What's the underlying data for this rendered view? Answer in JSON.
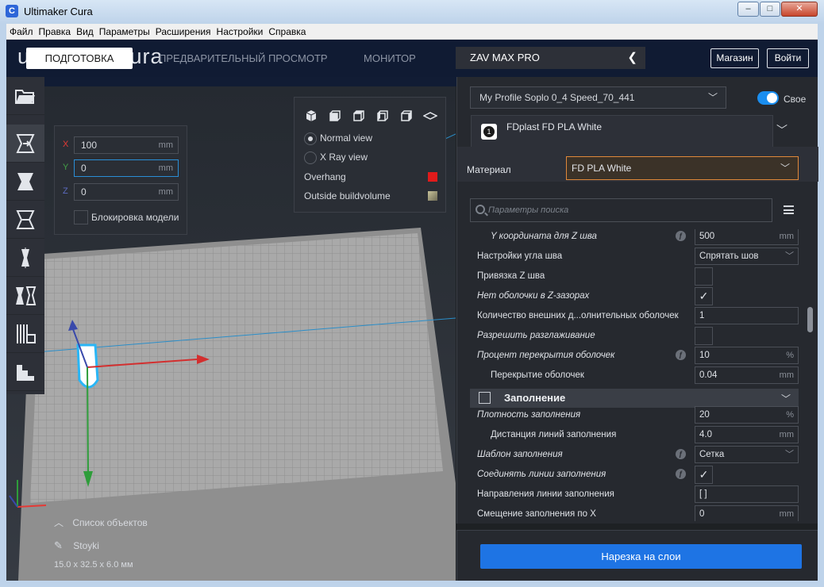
{
  "window": {
    "title": "Ultimaker Cura",
    "logo": "C",
    "buttons": [
      "–",
      "□",
      "✕"
    ]
  },
  "menubar": [
    "Файл",
    "Правка",
    "Вид",
    "Параметры",
    "Расширения",
    "Настройки",
    "Справка"
  ],
  "header": {
    "brand": "ultimaker cura",
    "stages": {
      "prepare": "ПОДГОТОВКА",
      "preview": "ПРЕДВАРИТЕЛЬНЫЙ ПРОСМОТР",
      "monitor": "МОНИТОР"
    },
    "printer": "ZAV MAX PRO",
    "shop": "Магазин",
    "login": "Войти"
  },
  "toolbar": {
    "icons": [
      "open-file-icon",
      "move-tool-icon",
      "scale-tool-icon",
      "rotate-tool-icon",
      "mirror-tool-icon",
      "per-model-settings-icon",
      "support-blocker-icon",
      "layflat-icon"
    ]
  },
  "move_panel": {
    "x": {
      "label": "X",
      "value": "100",
      "unit": "mm",
      "color": "#e53935"
    },
    "y": {
      "label": "Y",
      "value": "0",
      "unit": "mm",
      "color": "#43a047"
    },
    "z": {
      "label": "Z",
      "value": "0",
      "unit": "mm",
      "color": "#3f51b5"
    },
    "lock_label": "Блокировка модели"
  },
  "view_panel": {
    "normal": "Normal view",
    "xray": "X Ray view",
    "overhang": "Overhang",
    "overhang_color": "#e01b1b",
    "outside": "Outside buildvolume",
    "outside_color": "#8c8a70"
  },
  "object_list": {
    "title": "Список объектов",
    "name": "Stoyki",
    "dims": "15.0 x 32.5 x 6.0 мм"
  },
  "print_settings": {
    "profile": "My Profile Soplo 0_4 Speed_70_441",
    "custom_label": "Свое",
    "extruder_number": "1",
    "extruder_name": "FDplast FD PLA White",
    "material_label": "Материал",
    "material_value": "FD PLA White",
    "search_placeholder": "Параметры поиска"
  },
  "settings": [
    {
      "label": "Y координата для Z шва",
      "value": "500",
      "unit": "mm",
      "italic": true,
      "indent": true,
      "reset": true
    },
    {
      "label": "Настройки угла шва",
      "value": "Спрятать шов",
      "dropdown": true
    },
    {
      "label": "Привязка Z шва",
      "checkbox": ""
    },
    {
      "label": "Нет оболочки в Z-зазорах",
      "checkbox": "✓",
      "italic": true
    },
    {
      "label": "Количество внешних д...олнительных оболочек",
      "value": "1"
    },
    {
      "label": "Разрешить разглаживание",
      "checkbox": "",
      "italic": true
    },
    {
      "label": "Процент перекрытия оболочек",
      "value": "10",
      "unit": "%",
      "italic": true,
      "reset": true
    },
    {
      "label": "Перекрытие оболочек",
      "value": "0.04",
      "unit": "mm",
      "indent": true
    }
  ],
  "infill_category": "Заполнение",
  "infill_settings": [
    {
      "label": "Плотность заполнения",
      "value": "20",
      "unit": "%",
      "italic": true
    },
    {
      "label": "Дистанция линий заполнения",
      "value": "4.0",
      "unit": "mm",
      "indent": true
    },
    {
      "label": "Шаблон заполнения",
      "value": "Сетка",
      "dropdown": true,
      "italic": true,
      "reset": true
    },
    {
      "label": "Соединять линии заполнения",
      "checkbox": "✓",
      "italic": true,
      "reset": true
    },
    {
      "label": "Направления линии заполнения",
      "value": "[ ]"
    },
    {
      "label": "Смещение заполнения по X",
      "value": "0",
      "unit": "mm"
    }
  ],
  "slice_button": "Нарезка на слои"
}
